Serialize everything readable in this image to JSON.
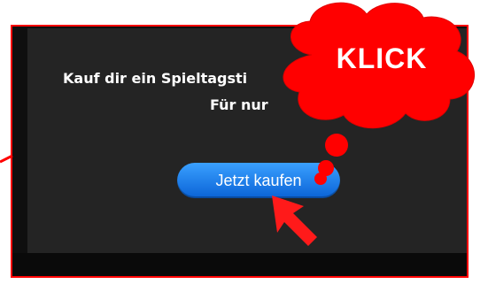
{
  "ad": {
    "headline": "Kauf dir ein Spieltagsti",
    "subline": "Für nur",
    "buy_button": "Jetzt kaufen"
  },
  "annotation": {
    "label": "KLICK"
  },
  "colors": {
    "annotation_red": "#ff0000",
    "button_blue": "#1f7df0",
    "panel_dark": "#242424"
  },
  "icons": [
    "speech-cloud-icon",
    "arrow-pointer-icon"
  ]
}
